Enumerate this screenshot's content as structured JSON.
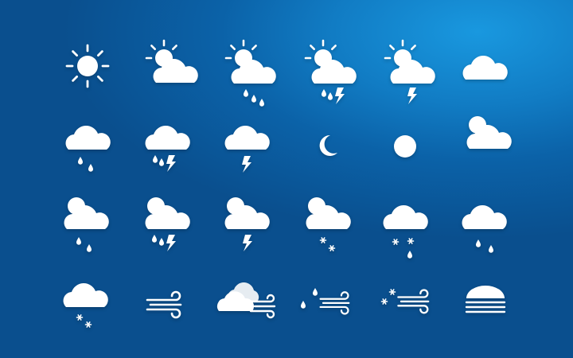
{
  "palette": {
    "background_light": "#1998df",
    "background_mid": "#117cc4",
    "background_dark": "#0a4f8e",
    "icon": "#ffffff"
  },
  "icons": [
    "sun-icon",
    "sun-behind-cloud-icon",
    "sun-cloud-rain-icon",
    "sun-cloud-rain-thunder-icon",
    "sun-cloud-thunder-icon",
    "cloud-icon",
    "cloud-rain-icon",
    "cloud-rain-thunder-icon",
    "cloud-thunder-icon",
    "moon-icon",
    "full-moon-icon",
    "partly-cloudy-icon",
    "partly-cloudy-rain-icon",
    "partly-cloudy-rain-thunder-icon",
    "partly-cloudy-thunder-icon",
    "partly-cloudy-snow-icon",
    "cloud-snow-rain-icon",
    "cloud-drizzle-icon",
    "cloud-snow-icon",
    "wind-icon",
    "clouds-wind-icon",
    "rain-wind-icon",
    "snow-wind-icon",
    "fog-icon"
  ]
}
